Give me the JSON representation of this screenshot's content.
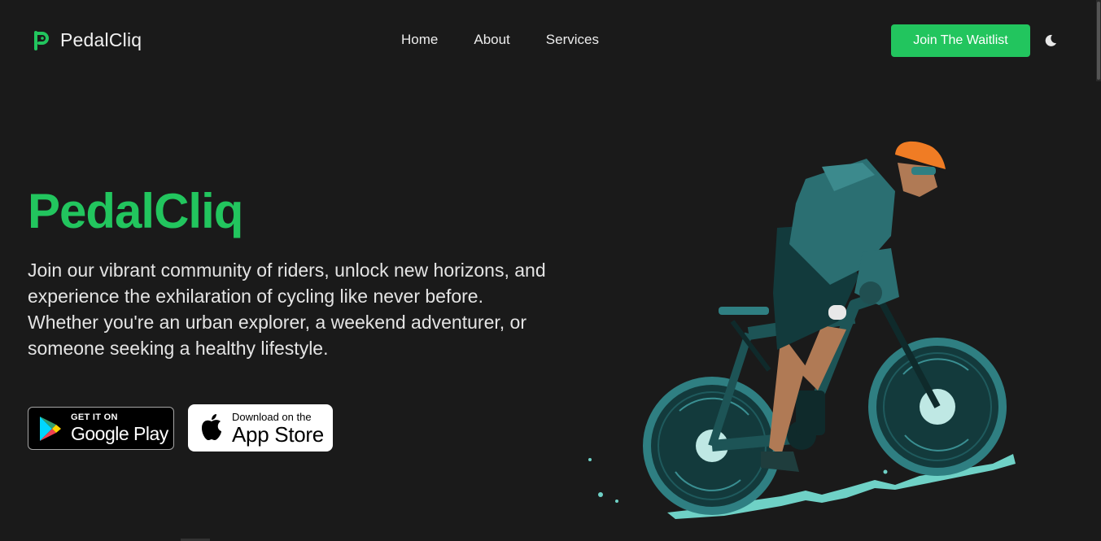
{
  "header": {
    "brand_name": "PedalCliq",
    "nav": [
      "Home",
      "About",
      "Services"
    ],
    "cta_label": "Join The Waitlist"
  },
  "hero": {
    "title": "PedalCliq",
    "description": "Join our vibrant community of riders, unlock new horizons, and experience the exhilaration of cycling like never before. Whether you're an urban explorer, a weekend adventurer, or someone seeking a healthy lifestyle.",
    "google_play": {
      "small": "GET IT ON",
      "big": "Google Play"
    },
    "app_store": {
      "small": "Download on the",
      "big": "App Store"
    }
  },
  "colors": {
    "accent": "#22c55e",
    "background": "#1a1a1a"
  },
  "icons": [
    "brand-logo-icon",
    "moon-icon",
    "google-play-icon",
    "apple-icon"
  ]
}
